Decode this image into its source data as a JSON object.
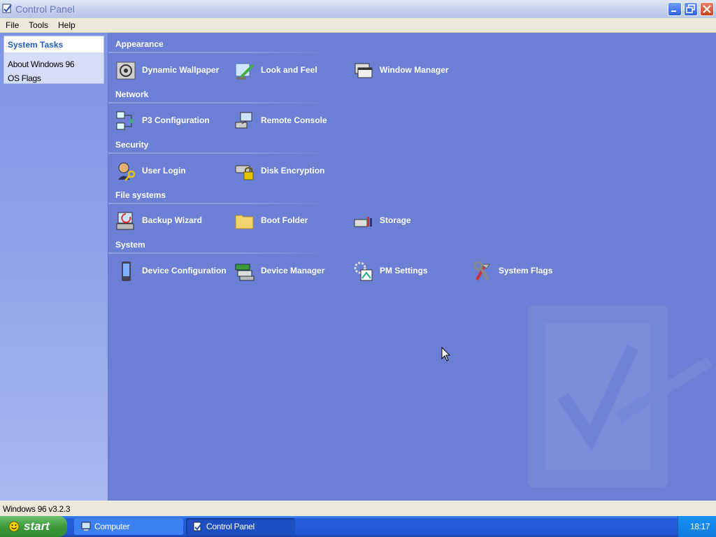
{
  "window": {
    "title": "Control Panel"
  },
  "menu": [
    "File",
    "Tools",
    "Help"
  ],
  "system_tasks": {
    "heading": "System Tasks",
    "links": [
      "About Windows 96",
      "OS Flags"
    ]
  },
  "sections": [
    {
      "title": "Appearance",
      "items": [
        {
          "label": "Dynamic Wallpaper",
          "icon": "wallpaper-icon"
        },
        {
          "label": "Look and Feel",
          "icon": "look-and-feel-icon"
        },
        {
          "label": "Window Manager",
          "icon": "window-manager-icon"
        }
      ]
    },
    {
      "title": "Network",
      "items": [
        {
          "label": "P3 Configuration",
          "icon": "network-computers-icon"
        },
        {
          "label": "Remote Console",
          "icon": "remote-console-icon"
        }
      ]
    },
    {
      "title": "Security",
      "items": [
        {
          "label": "User Login",
          "icon": "user-key-icon"
        },
        {
          "label": "Disk Encryption",
          "icon": "disk-lock-icon"
        }
      ]
    },
    {
      "title": "File systems",
      "items": [
        {
          "label": "Backup Wizard",
          "icon": "backup-icon"
        },
        {
          "label": "Boot Folder",
          "icon": "folder-icon"
        },
        {
          "label": "Storage",
          "icon": "storage-icon"
        }
      ]
    },
    {
      "title": "System",
      "items": [
        {
          "label": "Device Configuration",
          "icon": "device-phone-icon"
        },
        {
          "label": "Device Manager",
          "icon": "device-manager-icon"
        },
        {
          "label": "PM Settings",
          "icon": "pm-settings-icon"
        },
        {
          "label": "System Flags",
          "icon": "tools-icon"
        }
      ]
    }
  ],
  "status": "Windows 96 v3.2.3",
  "taskbar": {
    "start_label": "start",
    "buttons": [
      "Computer",
      "Control Panel"
    ],
    "clock": "18:17"
  },
  "colors": {
    "desktop": "#6b7fd4",
    "taskbar": "#245edb",
    "start": "#3c9b3c",
    "accent": "#215dc6"
  }
}
